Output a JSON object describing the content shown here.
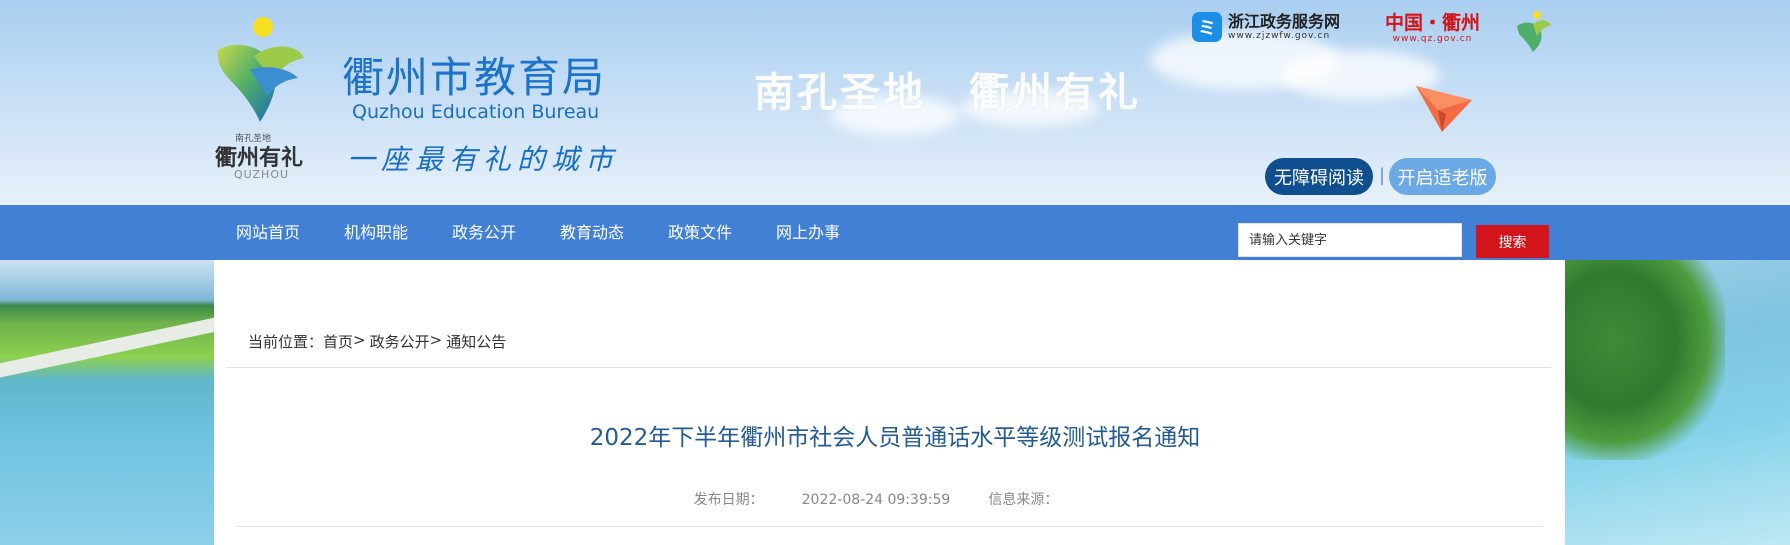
{
  "header": {
    "site_title": "衢州市教育局",
    "site_title_en": "Quzhou Education Bureau",
    "slogan": "一座最有礼的城市",
    "motto": "南孔圣地　衢州有礼",
    "logo_caption_small": "南孔圣地",
    "logo_caption": "衢州有礼",
    "logo_caption_en": "QUZHOU",
    "zjzwfw": {
      "name": "浙江政务服务网",
      "url": "www.zjzwfw.gov.cn"
    },
    "qzgov": {
      "name": "中国・衢州",
      "url": "www.qz.gov.cn"
    },
    "accessibility_button": "无障碍阅读",
    "elder_mode_button": "开启适老版",
    "separator": "|"
  },
  "nav": {
    "items": [
      {
        "label": "网站首页"
      },
      {
        "label": "机构职能"
      },
      {
        "label": "政务公开"
      },
      {
        "label": "教育动态"
      },
      {
        "label": "政策文件"
      },
      {
        "label": "网上办事"
      }
    ],
    "search_placeholder": "请输入关键字",
    "search_button": "搜索"
  },
  "breadcrumb": {
    "prefix": "当前位置：",
    "items": [
      {
        "label": "首页"
      },
      {
        "label": "政务公开"
      },
      {
        "label": "通知公告"
      }
    ],
    "separator": ">"
  },
  "article": {
    "title": "2022年下半年衢州市社会人员普通话水平等级测试报名通知",
    "publish_label": "发布日期：",
    "publish_date": "2022-08-24 09:39:59",
    "source_label": "信息来源：",
    "source": ""
  },
  "colors": {
    "nav_bg": "#4180d5",
    "title_color": "#235b96",
    "search_button_bg": "#d3141a",
    "accessibility_bg": "#0f4f8f",
    "elder_bg": "#6aa9e5"
  }
}
